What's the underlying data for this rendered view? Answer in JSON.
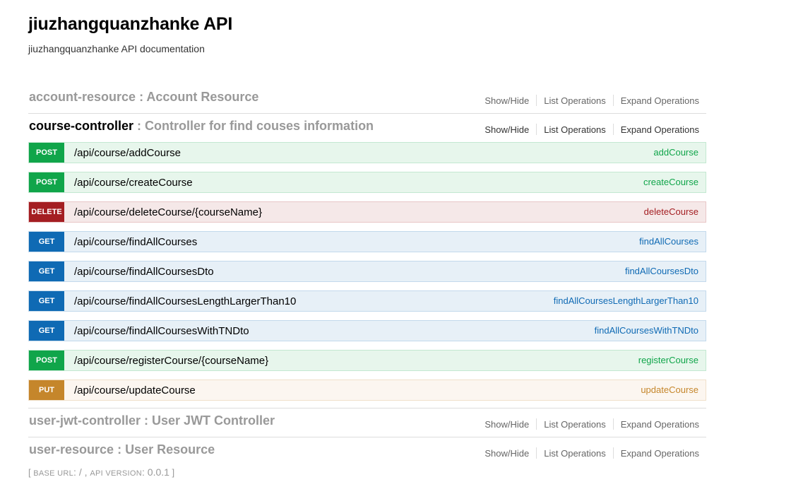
{
  "header": {
    "title": "jiuzhangquanzhanke API",
    "description": "jiuzhangquanzhanke API documentation"
  },
  "colors": {
    "post": "#10a54a",
    "delete": "#a41e22",
    "get": "#0f6ab4",
    "put": "#c5862b"
  },
  "operations_labels": {
    "show_hide": "Show/Hide",
    "list_operations": "List Operations",
    "expand_operations": "Expand Operations"
  },
  "resources": [
    {
      "name": "account-resource",
      "separator": " : ",
      "description": "Account Resource",
      "active": false,
      "endpoints": []
    },
    {
      "name": "course-controller",
      "separator": " : ",
      "description": "Controller for find couses information",
      "active": true,
      "endpoints": [
        {
          "method": "POST",
          "path": "/api/course/addCourse",
          "nickname": "addCourse"
        },
        {
          "method": "POST",
          "path": "/api/course/createCourse",
          "nickname": "createCourse"
        },
        {
          "method": "DELETE",
          "path": "/api/course/deleteCourse/{courseName}",
          "nickname": "deleteCourse"
        },
        {
          "method": "GET",
          "path": "/api/course/findAllCourses",
          "nickname": "findAllCourses"
        },
        {
          "method": "GET",
          "path": "/api/course/findAllCoursesDto",
          "nickname": "findAllCoursesDto"
        },
        {
          "method": "GET",
          "path": "/api/course/findAllCoursesLengthLargerThan10",
          "nickname": "findAllCoursesLengthLargerThan10"
        },
        {
          "method": "GET",
          "path": "/api/course/findAllCoursesWithTNDto",
          "nickname": "findAllCoursesWithTNDto"
        },
        {
          "method": "POST",
          "path": "/api/course/registerCourse/{courseName}",
          "nickname": "registerCourse"
        },
        {
          "method": "PUT",
          "path": "/api/course/updateCourse",
          "nickname": "updateCourse"
        }
      ]
    },
    {
      "name": "user-jwt-controller",
      "separator": " : ",
      "description": "User JWT Controller",
      "active": false,
      "endpoints": []
    },
    {
      "name": "user-resource",
      "separator": " : ",
      "description": "User Resource",
      "active": false,
      "endpoints": []
    }
  ],
  "footer": {
    "open": "[ ",
    "base_url_label": "base url",
    "base_url_value": ": / , ",
    "api_version_label": "api version",
    "api_version_value": ": 0.0.1",
    "close": " ]"
  }
}
